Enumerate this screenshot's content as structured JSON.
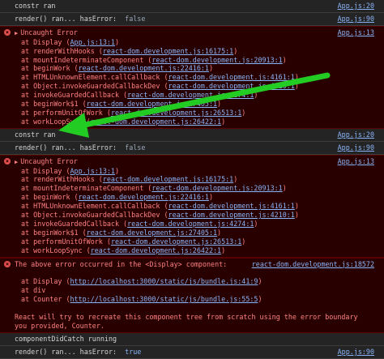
{
  "rows": [
    {
      "type": "log",
      "text": "constr ran",
      "src": "App.js:20"
    },
    {
      "type": "log",
      "text": "render() ran... hasError:",
      "value": "false",
      "src": "App.js:90"
    },
    {
      "type": "err",
      "text": "Uncaught Error",
      "src": "App.js:13",
      "frames": [
        {
          "fn": "at Display",
          "loc": "App.js:13:1"
        },
        {
          "fn": "at renderWithHooks",
          "loc": "react-dom.development.js:16175:1"
        },
        {
          "fn": "at mountIndeterminateComponent",
          "loc": "react-dom.development.js:20913:1"
        },
        {
          "fn": "at beginWork",
          "loc": "react-dom.development.js:22416:1"
        },
        {
          "fn": "at HTMLUnknownElement.callCallback",
          "loc": "react-dom.development.js:4161:1"
        },
        {
          "fn": "at Object.invokeGuardedCallbackDev",
          "loc": "react-dom.development.js:4210:1"
        },
        {
          "fn": "at invokeGuardedCallback",
          "loc": "react-dom.development.js:4274:1"
        },
        {
          "fn": "at beginWork$1",
          "loc": "react-dom.development.js:27405:1"
        },
        {
          "fn": "at performUnitOfWork",
          "loc": "react-dom.development.js:26513:1"
        },
        {
          "fn": "at workLoopSync",
          "loc": "react-dom.development.js:26422:1"
        }
      ]
    },
    {
      "type": "log",
      "text": "constr ran",
      "src": "App.js:20"
    },
    {
      "type": "log",
      "text": "render() ran... hasError:",
      "value": "false",
      "src": "App.js:90"
    },
    {
      "type": "err",
      "text": "Uncaught Error",
      "src": "App.js:13",
      "frames": [
        {
          "fn": "at Display",
          "loc": "App.js:13:1"
        },
        {
          "fn": "at renderWithHooks",
          "loc": "react-dom.development.js:16175:1"
        },
        {
          "fn": "at mountIndeterminateComponent",
          "loc": "react-dom.development.js:20913:1"
        },
        {
          "fn": "at beginWork",
          "loc": "react-dom.development.js:22416:1"
        },
        {
          "fn": "at HTMLUnknownElement.callCallback",
          "loc": "react-dom.development.js:4161:1"
        },
        {
          "fn": "at Object.invokeGuardedCallbackDev",
          "loc": "react-dom.development.js:4210:1"
        },
        {
          "fn": "at invokeGuardedCallback",
          "loc": "react-dom.development.js:4274:1"
        },
        {
          "fn": "at beginWork$1",
          "loc": "react-dom.development.js:27405:1"
        },
        {
          "fn": "at performUnitOfWork",
          "loc": "react-dom.development.js:26513:1"
        },
        {
          "fn": "at workLoopSync",
          "loc": "react-dom.development.js:26422:1"
        }
      ]
    },
    {
      "type": "err-boundary",
      "text": "The above error occurred in the <Display> component:",
      "src": "react-dom.development.js:18572",
      "frames": [
        {
          "fn": "at Display",
          "loc": "http://localhost:3000/static/js/bundle.js:41:9"
        },
        {
          "fn": "at div",
          "loc": ""
        },
        {
          "fn": "at Counter",
          "loc": "http://localhost:3000/static/js/bundle.js:55:5"
        }
      ],
      "footer": "React will try to recreate this component tree from scratch using the error boundary you provided, Counter."
    },
    {
      "type": "log",
      "text": "componentDidCatch running",
      "src": ""
    },
    {
      "type": "log",
      "text": "render() ran... hasError:",
      "value": "true",
      "src": "App.js:90"
    }
  ],
  "colors": {
    "arrow": "#22cc22",
    "link": "#8ab4f8",
    "error_bg": "#290000",
    "error_text": "#ff8080"
  }
}
